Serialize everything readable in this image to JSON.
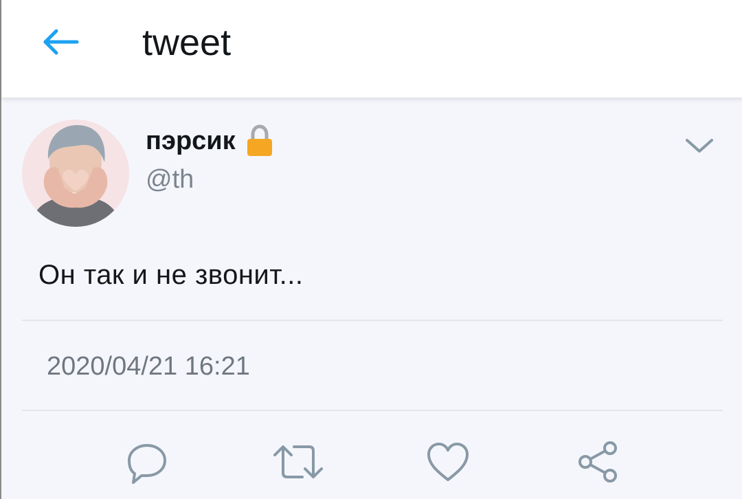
{
  "header": {
    "title": "tweet",
    "back_icon": "arrow-left-icon",
    "accent_color": "#1da1f2"
  },
  "tweet": {
    "author_name": "пэрсик",
    "author_handle": "@th",
    "lock_icon": "lock-icon",
    "menu_icon": "chevron-down-icon",
    "text": "Он так и не звонит...",
    "timestamp": "2020/04/21 16:21"
  },
  "actions": [
    {
      "icon": "reply-icon"
    },
    {
      "icon": "retweet-icon"
    },
    {
      "icon": "like-icon"
    },
    {
      "icon": "share-icon"
    }
  ],
  "colors": {
    "text": "#14171a",
    "secondary_text": "#7b8590",
    "icon_gray": "#8899a6",
    "background": "#f5f6fb"
  }
}
